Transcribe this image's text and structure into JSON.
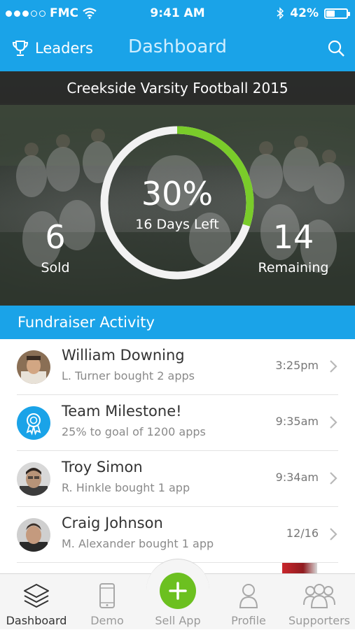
{
  "status_bar": {
    "carrier": "FMC",
    "time": "9:41 AM",
    "battery": "42%",
    "battery_level": 0.42
  },
  "nav": {
    "leaders_label": "Leaders",
    "title": "Dashboard"
  },
  "hero": {
    "title": "Creekside Varsity Football 2015",
    "progress_percent": "30%",
    "progress_fraction": 0.3,
    "days_left": "16 Days Left",
    "sold_count": "6",
    "sold_label": "Sold",
    "remaining_count": "14",
    "remaining_label": "Remaining"
  },
  "section": {
    "title": "Fundraiser Activity"
  },
  "activity": [
    {
      "name": "William Downing",
      "detail": "L. Turner bought 2 apps",
      "time": "3:25pm"
    },
    {
      "name": "Team Milestone!",
      "detail": "25% to goal of 1200 apps",
      "time": "9:35am"
    },
    {
      "name": "Troy Simon",
      "detail": "R. Hinkle bought 1 app",
      "time": "9:34am"
    },
    {
      "name": "Craig Johnson",
      "detail": "M. Alexander bought 1 app",
      "time": "12/16"
    }
  ],
  "tabs": {
    "dashboard": "Dashboard",
    "demo": "Demo",
    "sell_app": "Sell App",
    "profile": "Profile",
    "supporters": "Supporters"
  },
  "colors": {
    "primary": "#1aa3e8",
    "progress": "#7acc2a",
    "sell": "#6cc020"
  }
}
